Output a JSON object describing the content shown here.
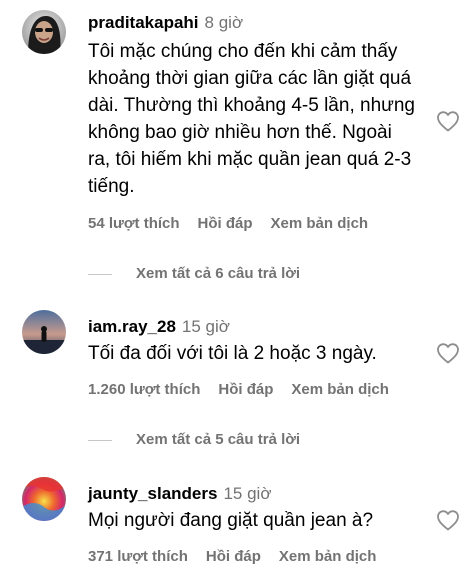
{
  "comments": [
    {
      "username": "praditakapahi",
      "time": "8 giờ",
      "text": "Tôi mặc chúng cho đến khi cảm thấy khoảng thời gian giữa các lần giặt quá dài. Thường thì khoảng 4-5 lần, nhưng không bao giờ nhiều hơn thế. Ngoài ra, tôi hiếm khi mặc quần jean quá 2-3 tiếng.",
      "likes": "54 lượt thích",
      "reply": "Hồi đáp",
      "translate": "Xem bản dịch",
      "view_replies": "Xem tất cả 6 câu trả lời"
    },
    {
      "username": "iam.ray_28",
      "time": "15 giờ",
      "text": "Tối đa đối với tôi là 2 hoặc 3 ngày.",
      "likes": "1.260 lượt thích",
      "reply": "Hồi đáp",
      "translate": "Xem bản dịch",
      "view_replies": "Xem tất cả 5 câu trả lời"
    },
    {
      "username": "jaunty_slanders",
      "time": "15 giờ",
      "text": "Mọi người đang giặt quần jean à?",
      "likes": "371 lượt thích",
      "reply": "Hồi đáp",
      "translate": "Xem bản dịch"
    }
  ],
  "colors": {
    "secondary_text": "#737373",
    "primary_text": "#000000",
    "divider": "#c7c7c7"
  },
  "icons": {
    "like": "heart-outline-icon"
  }
}
